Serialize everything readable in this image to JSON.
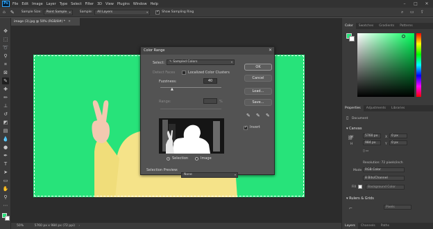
{
  "menu": {
    "logo": "Ps",
    "items": [
      "File",
      "Edit",
      "Image",
      "Layer",
      "Type",
      "Select",
      "Filter",
      "3D",
      "View",
      "Plugins",
      "Window",
      "Help"
    ]
  },
  "options": {
    "sample_size_label": "Sample Size:",
    "sample_size_value": "Point Sample",
    "sample_label": "Sample:",
    "sample_value": "All Layers",
    "show_ring_label": "Show Sampling Ring"
  },
  "document": {
    "tab_title": "image (3).jpg @ 50% (RGB/8#) *",
    "zoom": "50%",
    "status": "5760 px x 984 px (72 ppi)"
  },
  "dialog": {
    "title": "Color Range",
    "select_label": "Select:",
    "select_value": "Sampled Colors",
    "detect_faces_label": "Detect Faces",
    "localized_label": "Localized Color Clusters",
    "fuzziness_label": "Fuzziness:",
    "fuzziness_value": "40",
    "range_label": "Range:",
    "range_unit": "%",
    "selection_label": "Selection",
    "image_label": "Image",
    "preview_label": "Selection Preview:",
    "preview_value": "None",
    "ok_label": "OK",
    "cancel_label": "Cancel",
    "load_label": "Load...",
    "save_label": "Save...",
    "invert_label": "Invert"
  },
  "right_panel": {
    "color_tabs": [
      "Color",
      "Swatches",
      "Gradients",
      "Patterns"
    ],
    "props_tabs": [
      "Properties",
      "Adjustments",
      "Libraries"
    ],
    "document_label": "Document",
    "canvas_label": "Canvas",
    "w_value": "5760 px",
    "h_value": "984 px",
    "x_value": "0 px",
    "y_value": "0 px",
    "resolution": "Resolution: 72 pixels/inch",
    "mode_label": "Mode",
    "mode_value": "RGB Color",
    "depth_value": "8 Bits/Channel",
    "fill_label": "Fill",
    "fill_value": "Background Color",
    "rulers_label": "Rulers & Grids",
    "rulers_unit": "Pixels",
    "bottom_tabs": [
      "Layers",
      "Channels",
      "Paths"
    ]
  },
  "colors": {
    "canvas_green": "#27e37a",
    "sweater": "#f5e389",
    "skin": "#f2c9b0"
  }
}
